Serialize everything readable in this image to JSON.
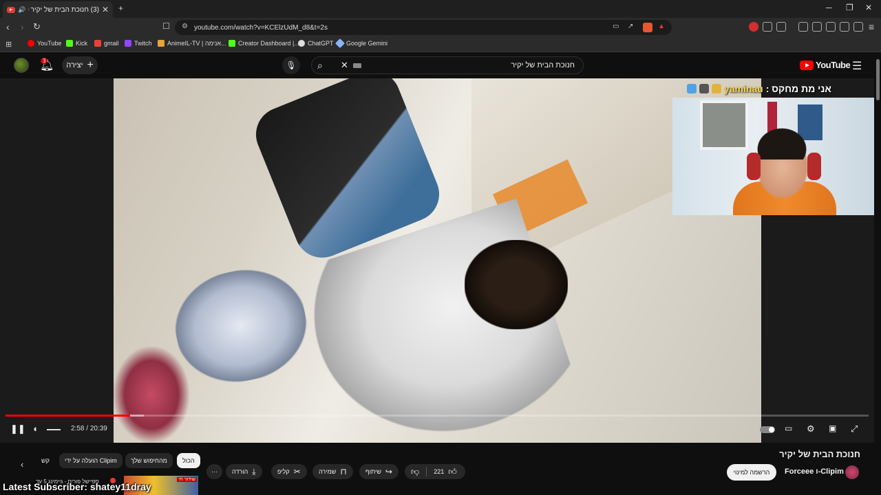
{
  "browser": {
    "tab": {
      "title": "(3) חנוכת הבית של יקיר ube",
      "close": "✕"
    },
    "new_tab": "+",
    "window": {
      "minimize": "─",
      "maximize": "❐",
      "close": "✕"
    },
    "url": "youtube.com/watch?v=KCElzUdM_d8&t=2s",
    "bookmarks": [
      {
        "label": "YouTube",
        "icon": "youtube-icon",
        "color": "#ff0000"
      },
      {
        "label": "Kick",
        "icon": "kick-icon",
        "color": "#53fc18"
      },
      {
        "label": "gmail",
        "icon": "gmail-icon",
        "color": "#ea4335"
      },
      {
        "label": "Twitch",
        "icon": "twitch-icon",
        "color": "#9146ff"
      },
      {
        "label": "AnimeIL-TV | אנימה...",
        "icon": "animeil-icon",
        "color": "#e6a23c"
      },
      {
        "label": "Creator Dashboard |...",
        "icon": "kick-icon",
        "color": "#53fc18"
      },
      {
        "label": "ChatGPT",
        "icon": "chatgpt-icon",
        "color": "#dddddd"
      },
      {
        "label": "Google Gemini",
        "icon": "gemini-icon",
        "color": "#8ab4f8"
      }
    ]
  },
  "youtube": {
    "notifications_count": "3",
    "create_label": "יצירה",
    "search_query": "חנוכת הבית של יקיר",
    "logo_text": "YouTube",
    "accent": "#ff0000"
  },
  "player": {
    "stream_overlay": {
      "prefix": "אני מת מחקס :",
      "username": "yaminau"
    },
    "time_current": "2:58",
    "time_total": "20:39",
    "time_separator": "/",
    "played_fraction": 0.144,
    "buffered_fraction": 0.16
  },
  "video": {
    "title": "חנוכת הבית של יקיר",
    "channel": "Forceee ו-Clipim",
    "subscribe_label": "הרשמה למינוי",
    "likes": "221",
    "actions": {
      "share": "שיתוף",
      "save": "שמירה",
      "clip": "קליפ",
      "download": "הורדה"
    }
  },
  "filter_chips": [
    "הכול",
    "מהחיפוש שלך",
    "הועלה על ידי Clipim",
    "קש"
  ],
  "recommendation": {
    "text": "ספיישל פורים - גיימינג 5 עד",
    "thumb_badge": "שידור חי"
  },
  "stream_banner": "Latest Subscriber: shatey11dray"
}
